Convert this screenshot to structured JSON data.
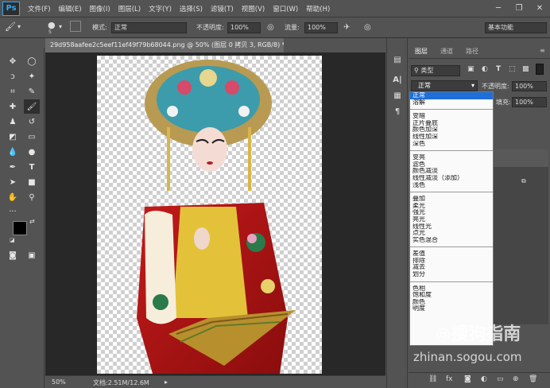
{
  "app": {
    "logo": "Ps",
    "menu": [
      "文件(F)",
      "编辑(E)",
      "图像(I)",
      "图层(L)",
      "文字(Y)",
      "选择(S)",
      "滤镜(T)",
      "视图(V)",
      "窗口(W)",
      "帮助(H)"
    ],
    "window_controls": [
      "─",
      "❐",
      "✕"
    ]
  },
  "options_bar": {
    "brush_size": "5",
    "mode_label": "模式:",
    "mode_value": "正常",
    "opacity_label": "不透明度:",
    "opacity_value": "100%",
    "flow_label": "流量:",
    "flow_value": "100%",
    "workspace": "基本功能"
  },
  "document": {
    "tab_title": "29d958aafee2c5eef11ef49f79b68044.png @ 50% (图层 0 拷贝 3, RGB/8) *",
    "tab_close": "×",
    "zoom": "50%",
    "doc_size": "文档:2.51M/12.6M"
  },
  "layers_panel": {
    "tabs": [
      "图层",
      "通道",
      "路径"
    ],
    "filter_label": "类型",
    "blend_value": "正常",
    "opacity_label": "不透明度:",
    "opacity_value": "100%",
    "fill_label": "填充:",
    "fill_value": "100%"
  },
  "blend_modes": [
    [
      "正常",
      "溶解"
    ],
    [
      "变暗",
      "正片叠底",
      "颜色加深",
      "线性加深",
      "深色"
    ],
    [
      "变亮",
      "滤色",
      "颜色减淡",
      "线性减淡（添加）",
      "浅色"
    ],
    [
      "叠加",
      "柔光",
      "强光",
      "亮光",
      "线性光",
      "点光",
      "实色混合"
    ],
    [
      "差值",
      "排除",
      "减去",
      "划分"
    ],
    [
      "色相",
      "饱和度",
      "颜色",
      "明度"
    ]
  ],
  "watermark": {
    "brand": "搜狗指南",
    "url": "zhinan.sogou.com"
  },
  "colors": {
    "ui_bg": "#535353",
    "canvas_bg": "#282828",
    "selection": "#1e6fd8",
    "ps_blue": "#31a8ff"
  }
}
